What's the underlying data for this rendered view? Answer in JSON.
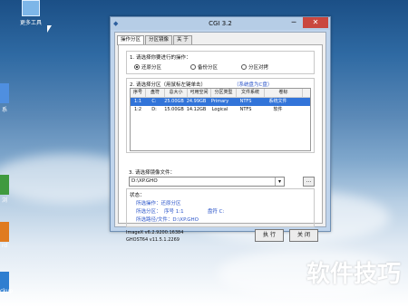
{
  "desktop": {
    "icon_label": "更多工具",
    "left_label_1": "系",
    "left_label_2": "浏",
    "left_label_3": "rd",
    "left_label_4": "ckup"
  },
  "window": {
    "title": "CGI 3.2",
    "tabs": [
      "操作分区",
      "分区镜像",
      "关 于"
    ],
    "section1_label": "1. 请选择你要进行的操作：",
    "operations": [
      "还原分区",
      "备份分区",
      "分区对拷"
    ],
    "section2_label": "2. 请选择分区（用鼠标左键单击）",
    "system_disk_label": "（系统盘为C盘）",
    "table_headers": [
      "序号",
      "盘符",
      "总大小",
      "可用空间",
      "分区类型",
      "文件系统",
      "卷标"
    ],
    "table_rows": [
      [
        "1:1",
        "C:",
        "25.00GB",
        "24.99GB",
        "Primary",
        "NTFS",
        "系统文件"
      ],
      [
        "1:2",
        "D:",
        "15.00GB",
        "14.12GB",
        "Logical",
        "NTFS",
        "软件"
      ]
    ],
    "section3_label": "3. 请选择镜像文件：",
    "image_path": "D:\\XP.GHO",
    "browse_label": "...",
    "status_label": "状态：",
    "status_lines": [
      "所选操作：还原分区",
      "所选分区：  序号 1:1               盘符 C:",
      "所选路径/文件：D:\\XP.GHO"
    ],
    "imagex_version": "ImageX v6.2.9200.16384",
    "ghost_version": "GHOST64 v11.5.1.2269",
    "execute_label": "执 行",
    "close_label": "关 闭",
    "title_min": "─",
    "title_close": "✕"
  },
  "watermark": "软件技巧",
  "colors": {
    "selection": "#3274d9",
    "status_text": "#2a54c9",
    "close_button": "#c9473f"
  }
}
